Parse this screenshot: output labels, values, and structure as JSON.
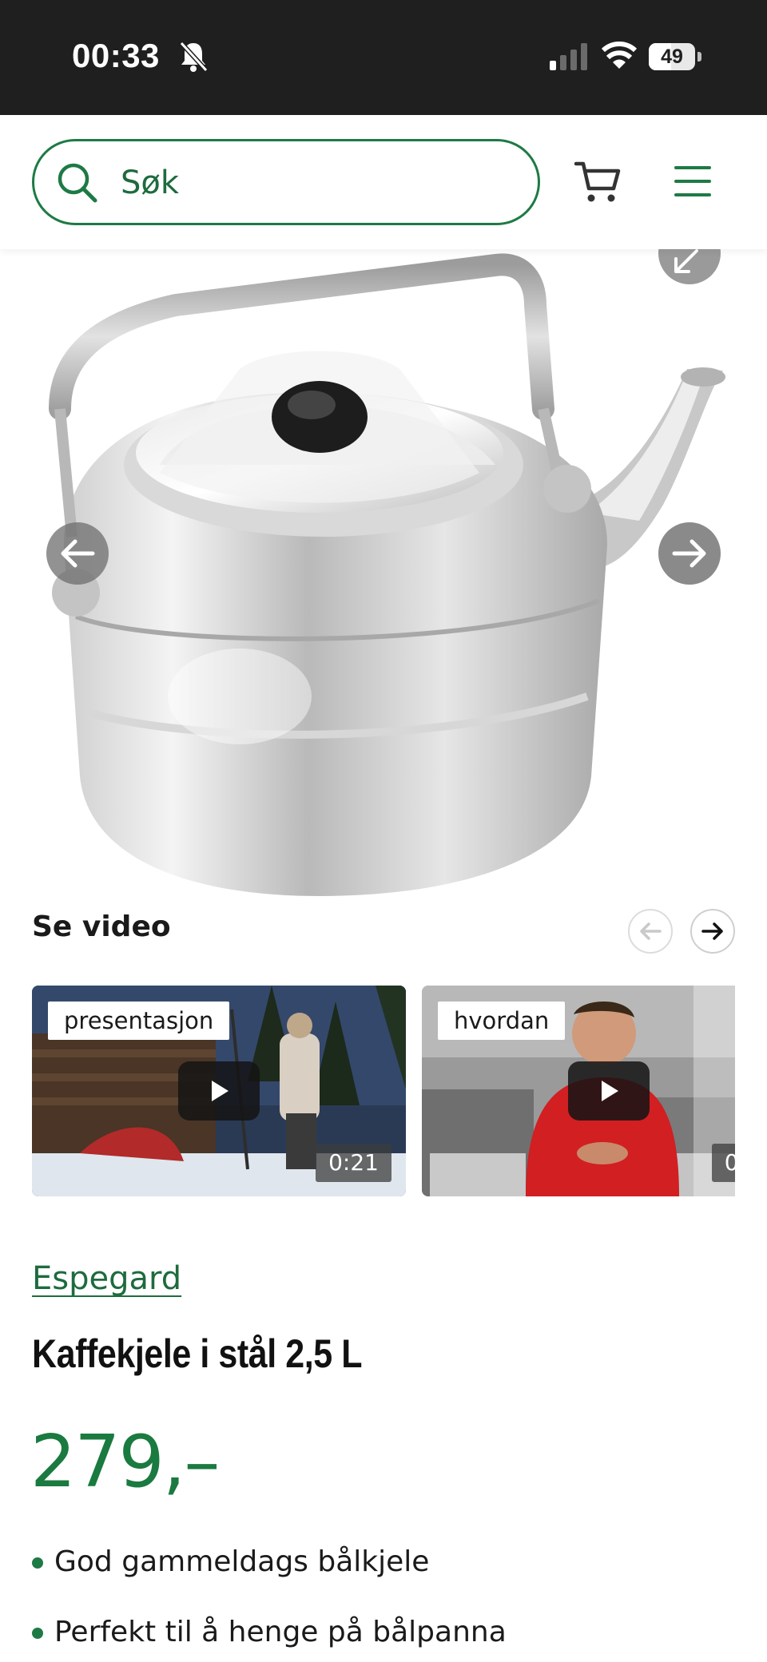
{
  "status_bar": {
    "time": "00:33",
    "battery": "49",
    "battery_level": 0.49
  },
  "header": {
    "search_placeholder": "Søk",
    "icons": [
      "search-icon",
      "cart-icon",
      "menu-icon"
    ]
  },
  "gallery": {
    "icons": [
      "expand-icon",
      "arrow-left-icon",
      "arrow-right-icon"
    ]
  },
  "video_section": {
    "title": "Se video",
    "videos": [
      {
        "tag": "presentasjon",
        "duration": "0:21"
      },
      {
        "tag": "hvordan",
        "duration": "0:"
      }
    ]
  },
  "product": {
    "brand": "Espegard",
    "name": "Kaffekjele i stål 2,5 L",
    "price": "279,–",
    "features": [
      "God gammeldags bålkjele",
      "Perfekt til å henge på bålpanna"
    ]
  },
  "colors": {
    "brand_green": "#1e7a45",
    "status_bar": "#1f1f1f"
  }
}
